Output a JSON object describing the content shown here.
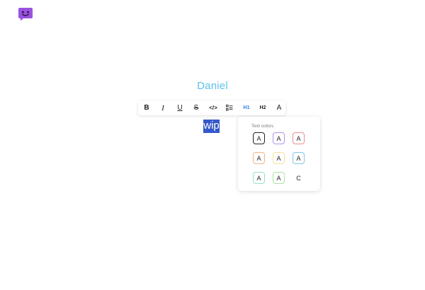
{
  "app": {
    "logo_icon": "smiley-chat-bubble-icon",
    "logo_color": "#9a52e0"
  },
  "document": {
    "title": "Daniel",
    "selected_text": "wip"
  },
  "toolbar": {
    "buttons": [
      {
        "name": "bold-button",
        "icon": "bold-icon",
        "label": "B"
      },
      {
        "name": "italic-button",
        "icon": "italic-icon",
        "label": "I"
      },
      {
        "name": "underline-button",
        "icon": "underline-icon",
        "label": "U"
      },
      {
        "name": "strikethrough-button",
        "icon": "strikethrough-icon",
        "label": "S"
      },
      {
        "name": "code-button",
        "icon": "code-icon",
        "label": "</>"
      },
      {
        "name": "checklist-button",
        "icon": "checklist-icon",
        "label": ""
      },
      {
        "name": "heading1-button",
        "icon": "heading1-icon",
        "label": "H1",
        "active": true
      },
      {
        "name": "heading2-button",
        "icon": "heading2-icon",
        "label": "H2"
      },
      {
        "name": "text-color-button",
        "icon": "text-color-icon",
        "label": "A"
      }
    ],
    "active_color": "#2a7ee0"
  },
  "text_colors": {
    "heading": "Text colors",
    "swatch_label": "A",
    "reset_label": "C",
    "swatches": [
      {
        "color": "#222222",
        "selected": true
      },
      {
        "color": "#b690f0"
      },
      {
        "color": "#f08b8b"
      },
      {
        "color": "#f5b27a"
      },
      {
        "color": "#f3e19a"
      },
      {
        "color": "#7ec7ea"
      },
      {
        "color": "#8fe3cf"
      },
      {
        "color": "#a8e4a0"
      }
    ]
  }
}
